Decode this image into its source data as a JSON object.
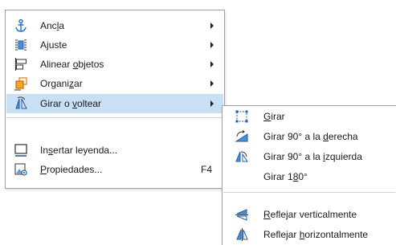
{
  "main_menu": {
    "items": [
      {
        "label_pre": "Anc",
        "label_ul": "l",
        "label_post": "a",
        "icon": "anchor-icon",
        "has_submenu": true
      },
      {
        "label_pre": "A",
        "label_ul": "j",
        "label_post": "uste",
        "icon": "wrap-icon",
        "has_submenu": true
      },
      {
        "label_pre": "Alinear ",
        "label_ul": "o",
        "label_post": "bjetos",
        "icon": "align-objects-icon",
        "has_submenu": true
      },
      {
        "label_pre": "Organi",
        "label_ul": "z",
        "label_post": "ar",
        "icon": "arrange-icon",
        "has_submenu": true
      },
      {
        "label_pre": "Girar o ",
        "label_ul": "v",
        "label_post": "oltear",
        "icon": "rotate-flip-icon",
        "has_submenu": true,
        "highlighted": true
      },
      {
        "label_pre": "In",
        "label_ul": "s",
        "label_post": "ertar leyenda...",
        "icon": "insert-caption-icon",
        "has_submenu": false
      },
      {
        "label_pre": "",
        "label_ul": "P",
        "label_post": "ropiedades...",
        "icon": "properties-icon",
        "has_submenu": false,
        "shortcut": "F4"
      }
    ],
    "highlight_color": "#c9dff3"
  },
  "sub_menu": {
    "items": [
      {
        "label_pre": "",
        "label_ul": "G",
        "label_post": "irar",
        "icon": "rotate-icon"
      },
      {
        "label_pre": "Girar 90° a la ",
        "label_ul": "d",
        "label_post": "erecha",
        "icon": "rotate-right-icon"
      },
      {
        "label_pre": "Girar 90° a la ",
        "label_ul": "i",
        "label_post": "zquierda",
        "icon": "rotate-left-icon"
      },
      {
        "label_pre": "Girar 1",
        "label_ul": "8",
        "label_post": "0°",
        "icon": ""
      },
      {
        "label_pre": "",
        "label_ul": "R",
        "label_post": "eflejar verticalmente",
        "icon": "flip-vertical-icon"
      },
      {
        "label_pre": "Reflejar ",
        "label_ul": "h",
        "label_post": "orizontalmente",
        "icon": "flip-horizontal-icon"
      }
    ]
  }
}
